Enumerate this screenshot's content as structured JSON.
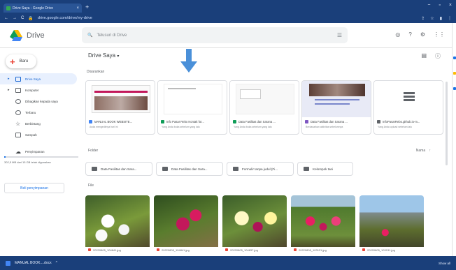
{
  "browser": {
    "tab_title": "Drive Saya - Google Drive",
    "tab_close": "×",
    "new_tab": "+",
    "address": "drive.google.com/drive/my-drive",
    "window_controls": [
      "−",
      "▫",
      "×"
    ]
  },
  "header": {
    "app_name": "Drive",
    "search_placeholder": "Telusuri di Drive",
    "icons": [
      "help-icon",
      "settings-icon",
      "apps-icon"
    ]
  },
  "sidebar": {
    "new_label": "Baru",
    "items": [
      {
        "label": "Drive Saya",
        "active": true
      },
      {
        "label": "Komputer",
        "active": false
      },
      {
        "label": "Dibagikan kepada saya",
        "active": false
      },
      {
        "label": "Terbaru",
        "active": false
      },
      {
        "label": "Berbintang",
        "active": false
      },
      {
        "label": "Sampah",
        "active": false
      },
      {
        "label": "Penyimpanan",
        "active": false
      }
    ],
    "storage_text": "302,5 MB dari 15 GB telah digunakan",
    "buy_label": "Beli penyimpanan"
  },
  "main": {
    "title": "Drive Saya",
    "title_caret": "▾",
    "suggested_label": "Disarankan",
    "suggested": [
      {
        "title": "MANUAL BOOK WEBSITE...",
        "sub": "Anda mengeditnya hari ini",
        "color": "#4285f4"
      },
      {
        "title": "Info Pasar Rebo Kontak for...",
        "sub": "Yang Anda buka sebelum yang lalu",
        "color": "#0f9d58"
      },
      {
        "title": "Data Fasilitas dan Sarana ...",
        "sub": "Yang Anda buka sebelum yang lalu",
        "color": "#0f9d58"
      },
      {
        "title": "Data Fasilitas dan Sarana ...",
        "sub": "Berdasarkan aktivitas sebelumnya",
        "color": "#7e57c2"
      },
      {
        "title": "InfoPasarRebo.github.io-m...",
        "sub": "Yang Anda upload sebelum lalu",
        "color": "#5f6368"
      }
    ],
    "folder_label": "Folder",
    "sort_label": "Nama",
    "sort_arrow": "↑",
    "folders": [
      "Data Fasilitas dan Sara...",
      "Data Fasilitas dan Sara...",
      "Formulir tanpa judul (Fi...",
      "Kelompok tani"
    ],
    "file_label": "File",
    "files": [
      "20220805_104841.jpg",
      "20220805_104841.jpg",
      "20220805_104837.jpg",
      "20220805_103121.jpg",
      "20220805_103131.jpg"
    ]
  },
  "download_bar": {
    "file": "MANUAL BOOK....docx",
    "caret": "^",
    "show_all": "Show all"
  },
  "colors": {
    "chrome": "#1a3f7a",
    "accent": "#1a73e8",
    "active_bg": "#e8f0fe",
    "arrow": "#4a90d9"
  }
}
